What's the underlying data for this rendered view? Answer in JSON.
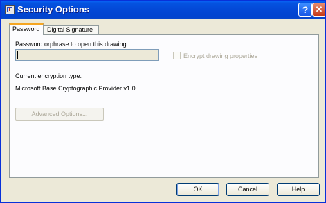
{
  "window": {
    "title": "Security Options"
  },
  "titlebar": {
    "help_glyph": "?",
    "close_glyph": "✕"
  },
  "tabs": [
    {
      "label": "Password"
    },
    {
      "label": "Digital Signature"
    }
  ],
  "password_tab": {
    "password_label": "Password orphrase to open this drawing:",
    "password_value": "",
    "encrypt_label": "Encrypt drawing properties",
    "encrypt_checked": false,
    "encryption_type_label": "Current encryption type:",
    "encryption_type_value": "Microsoft Base Cryptographic Provider v1.0",
    "advanced_button": "Advanced Options..."
  },
  "footer": {
    "ok": "OK",
    "cancel": "Cancel",
    "help": "Help"
  }
}
